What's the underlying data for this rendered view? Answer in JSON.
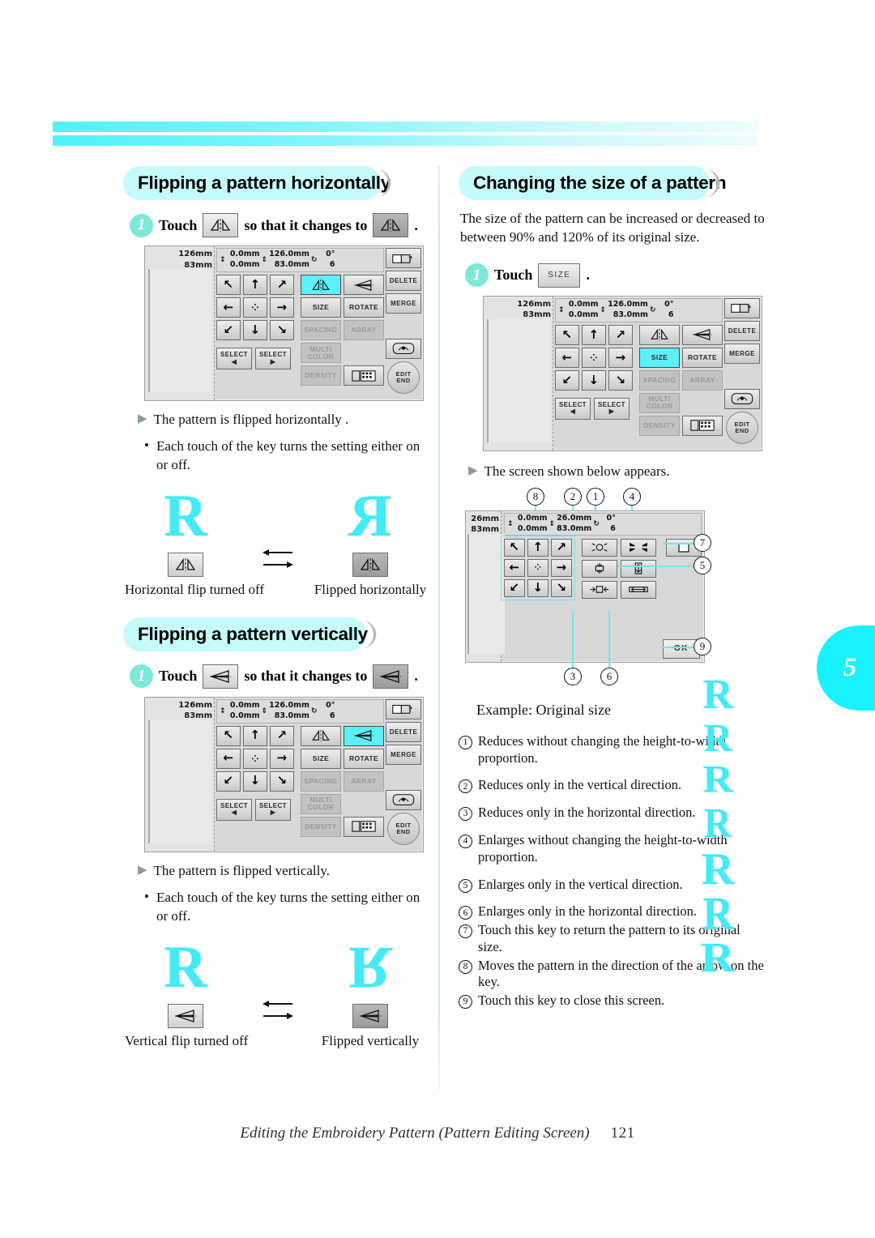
{
  "page": {
    "number": "121",
    "tab_number": "5",
    "footer_title": "Editing the Embroidery Pattern (Pattern Editing Screen)"
  },
  "sections": {
    "flip_horizontal": {
      "heading": "Flipping a pattern horizontally",
      "step_number": "1",
      "step_prefix": "Touch",
      "step_middle": "so that it changes to",
      "step_suffix": ".",
      "result": "The pattern is flipped horizontally .",
      "note": "Each touch of the key turns the setting either on or off.",
      "caption_off": "Horizontal flip turned off",
      "caption_on": "Flipped horizontally"
    },
    "flip_vertical": {
      "heading": "Flipping a pattern vertically",
      "step_number": "1",
      "step_prefix": "Touch",
      "step_middle": "so that it changes to",
      "step_suffix": ".",
      "result": "The pattern is flipped vertically.",
      "note": "Each touch of the key turns the setting either on or off.",
      "caption_off": "Vertical flip turned off",
      "caption_on": "Flipped vertically"
    },
    "change_size": {
      "heading": "Changing the size of a pattern",
      "intro": "The size of the pattern can be increased or decreased to between 90% and 120% of its original size.",
      "step_number": "1",
      "step_prefix": "Touch",
      "step_key_label": "SIZE",
      "step_suffix": ".",
      "result": "The screen shown below appears.",
      "example_caption": "Example: Original size"
    }
  },
  "lcd": {
    "dims_height": "126mm",
    "dims_width": "83mm",
    "status": {
      "v_offset": "0.0mm",
      "h_offset": "0.0mm",
      "height": "126.0mm",
      "width": "83.0mm",
      "rotation": "0°",
      "colors": "6"
    },
    "arrow_keys": [
      "↖",
      "↑",
      "↗",
      "←",
      "✲",
      "→",
      "↙",
      "↓",
      "↘"
    ],
    "select_prev": "SELECT",
    "select_prev_arrow": "◀",
    "select_next": "SELECT",
    "select_next_arrow": "▶",
    "function_keys": [
      {
        "label": "flip-h",
        "text": ""
      },
      {
        "label": "flip-v",
        "text": ""
      },
      {
        "label": "SIZE",
        "text": "SIZE"
      },
      {
        "label": "ROTATE",
        "text": "ROTATE"
      },
      {
        "label": "SPACING",
        "text": "SPACING"
      },
      {
        "label": "ARRAY",
        "text": "ARRAY"
      },
      {
        "label": "MULTI COLOR",
        "text": "MULTI COLOR"
      },
      {
        "label": "DENSITY",
        "text": "DENSITY"
      }
    ],
    "side_keys": [
      "DELETE",
      "MERGE"
    ],
    "edit_end_line1": "EDIT",
    "edit_end_line2": "END"
  },
  "lcd_size_dialog": {
    "dims_height": "26mm",
    "dims_width": "83mm",
    "status": {
      "v_offset": "0.0mm",
      "h_offset": "0.0mm",
      "height": "26.0mm",
      "width": "83.0mm",
      "rotation": "0°",
      "colors": "6"
    },
    "ok_label": "OK",
    "callouts_top": [
      "8",
      "2",
      "1",
      "4"
    ],
    "callouts_right": [
      "7",
      "5",
      "9"
    ],
    "callouts_bottom": [
      "3",
      "6"
    ]
  },
  "explanations": [
    {
      "num": "1",
      "text": "Reduces without changing the height-to-width proportion."
    },
    {
      "num": "2",
      "text": "Reduces only in the vertical direction."
    },
    {
      "num": "3",
      "text": "Reduces only in the horizontal direction."
    },
    {
      "num": "4",
      "text": "Enlarges without changing the height-to-width proportion."
    },
    {
      "num": "5",
      "text": "Enlarges only in the vertical direction."
    },
    {
      "num": "6",
      "text": "Enlarges only in the horizontal direction."
    },
    {
      "num": "7",
      "text": "Touch this key to return the pattern to its original size."
    },
    {
      "num": "8",
      "text": "Moves the pattern in the direction of the arrow on the key."
    },
    {
      "num": "9",
      "text": "Touch this key to close this screen."
    }
  ],
  "colors": {
    "accent_cyan": "#18f2ff",
    "band_cyan": "#c6fbfb",
    "pattern_cyan": "#45eaf4",
    "highlight_key": "#5ef0fa",
    "badge_teal": "#7de8d8"
  },
  "pattern_glyph": "R"
}
